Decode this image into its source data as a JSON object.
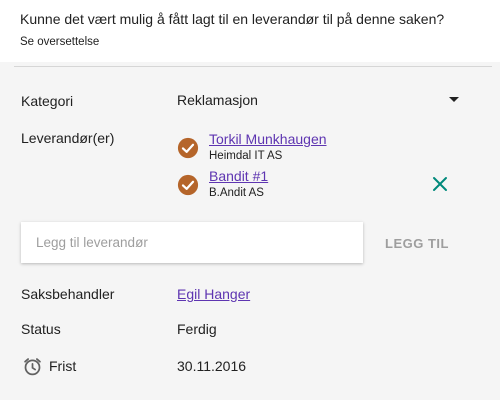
{
  "header": {
    "question": "Kunne det vært mulig å fått lagt til en leverandør til på denne saken?",
    "translate_link": "Se oversettelse"
  },
  "details": {
    "category": {
      "label": "Kategori",
      "value": "Reklamasjon"
    },
    "suppliers": {
      "label": "Leverandør(er)",
      "items": [
        {
          "name": "Torkil Munkhaugen",
          "company": "Heimdal IT AS"
        },
        {
          "name": "Bandit #1",
          "company": "B.Andit AS"
        }
      ],
      "add_placeholder": "Legg til leverandør",
      "add_button": "LEGG TIL"
    },
    "case_handler": {
      "label": "Saksbehandler",
      "value": "Egil Hanger"
    },
    "status": {
      "label": "Status",
      "value": "Ferdig"
    },
    "deadline": {
      "label": "Frist",
      "value": "30.11.2016"
    }
  },
  "colors": {
    "check": "#b5652a",
    "remove": "#00897b",
    "link": "#5e35b1"
  }
}
